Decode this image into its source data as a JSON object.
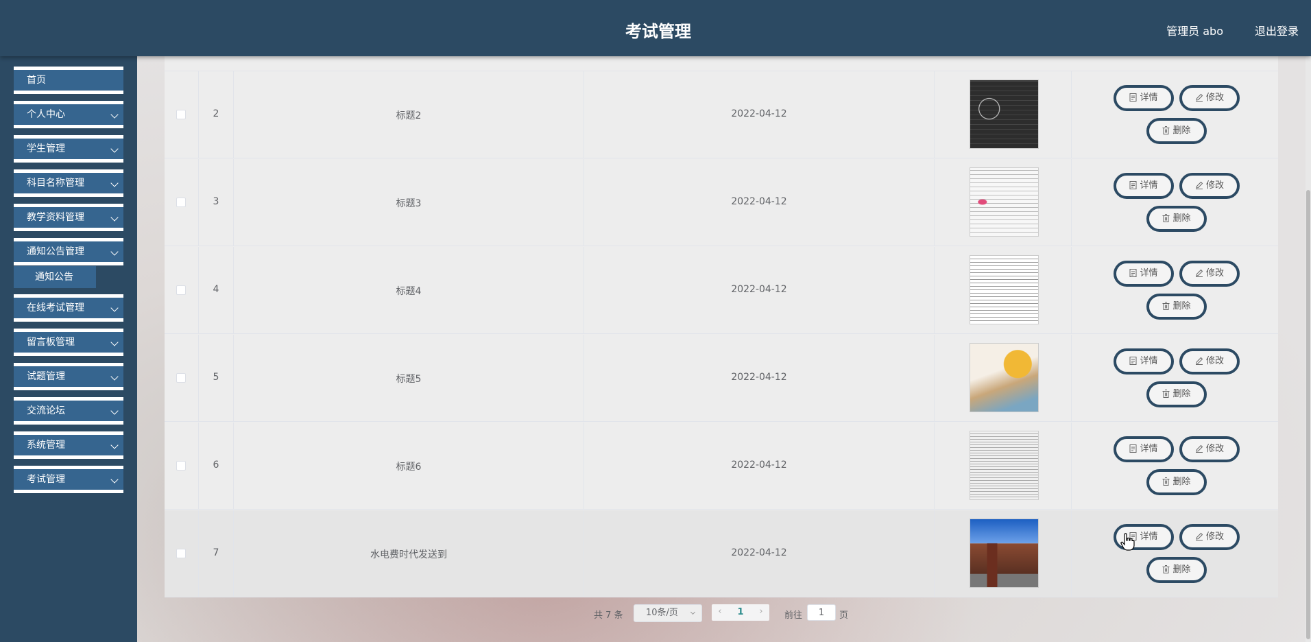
{
  "header": {
    "title": "考试管理",
    "user": "管理员 abo",
    "logout": "退出登录"
  },
  "sidebar": {
    "items": [
      {
        "label": "首页",
        "arrow": false
      },
      {
        "label": "个人中心",
        "arrow": true
      },
      {
        "label": "学生管理",
        "arrow": true
      },
      {
        "label": "科目名称管理",
        "arrow": true
      },
      {
        "label": "教学资料管理",
        "arrow": true
      },
      {
        "label": "通知公告管理",
        "arrow": true
      },
      {
        "label": "在线考试管理",
        "arrow": true
      },
      {
        "label": "留言板管理",
        "arrow": true
      },
      {
        "label": "试题管理",
        "arrow": true
      },
      {
        "label": "交流论坛",
        "arrow": true
      },
      {
        "label": "系统管理",
        "arrow": true
      },
      {
        "label": "考试管理",
        "arrow": true
      }
    ],
    "submenu": {
      "label": "通知公告"
    }
  },
  "table": {
    "rows": [
      {
        "index": "2",
        "title": "标题2",
        "date": "2022-04-12",
        "image": "blackboard"
      },
      {
        "index": "3",
        "title": "标题3",
        "date": "2022-04-12",
        "image": "mindmap"
      },
      {
        "index": "4",
        "title": "标题4",
        "date": "2022-04-12",
        "image": "document"
      },
      {
        "index": "5",
        "title": "标题5",
        "date": "2022-04-12",
        "image": "illustration"
      },
      {
        "index": "6",
        "title": "标题6",
        "date": "2022-04-12",
        "image": "table-scan"
      },
      {
        "index": "7",
        "title": "水电费时代发送到",
        "date": "2022-04-12",
        "image": "building"
      }
    ],
    "actions": {
      "detail": "详情",
      "edit": "修改",
      "delete": "删除"
    }
  },
  "pagination": {
    "total": "共 7 条",
    "page_size": "10条/页",
    "current_page": "1",
    "goto_label": "前往",
    "goto_value": "1",
    "page_suffix": "页"
  },
  "colors": {
    "primary": "#2c4a63",
    "menu": "#36658f"
  }
}
